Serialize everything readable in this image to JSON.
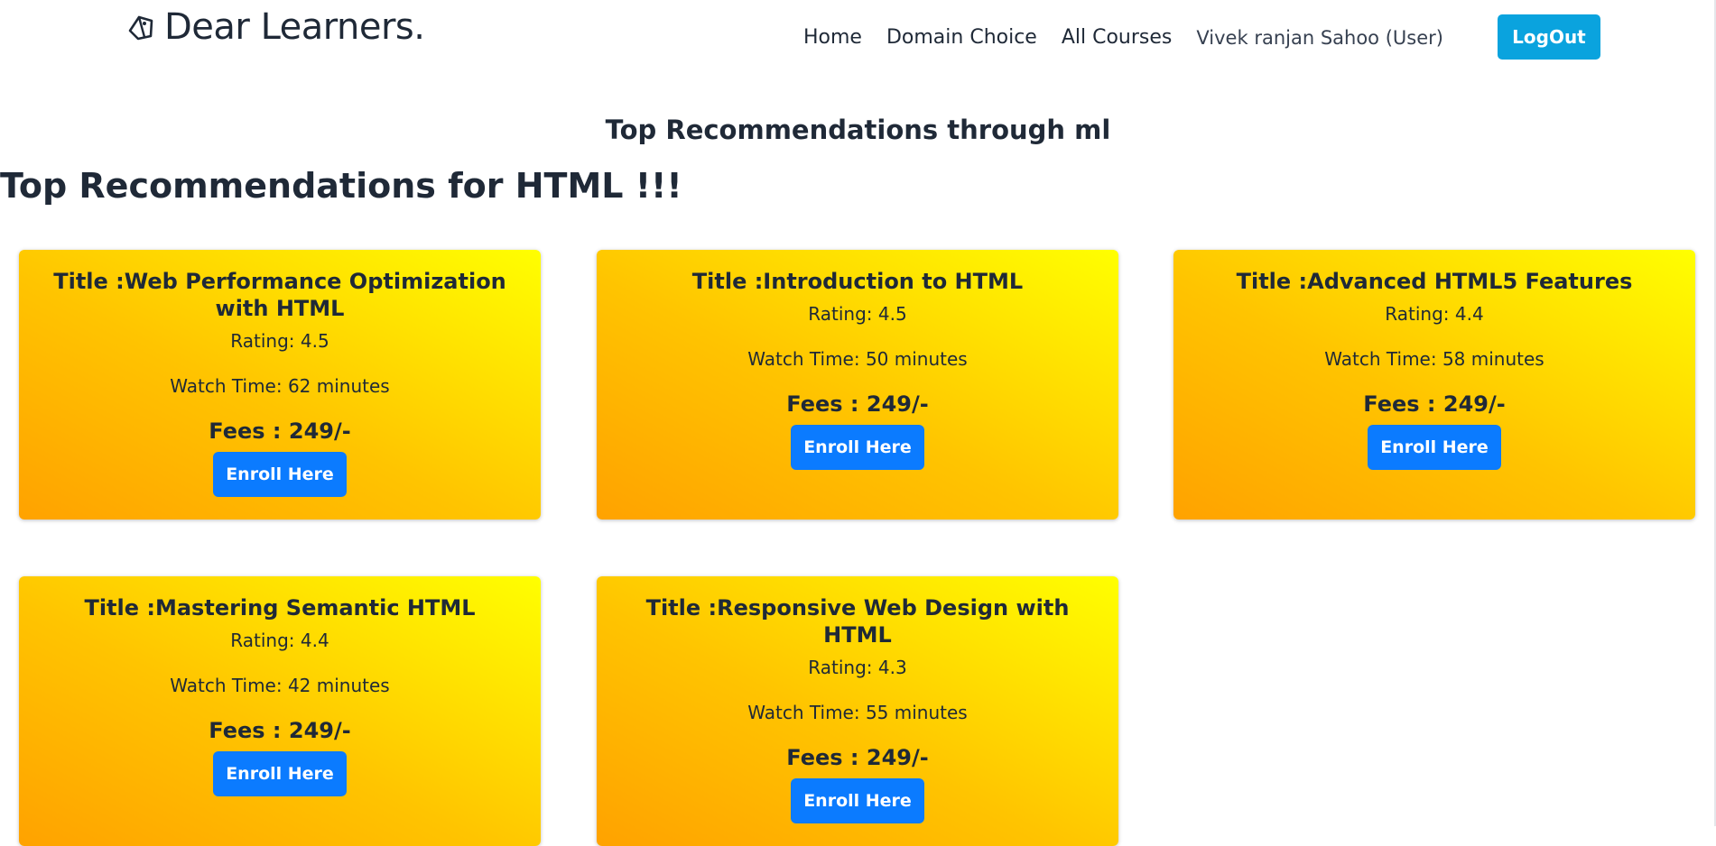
{
  "navbar": {
    "brand": "Dear Learners.",
    "brand_icon": "tag-icon",
    "links": [
      "Home",
      "Domain Choice",
      "All Courses"
    ],
    "user": "Vivek ranjan Sahoo (User)",
    "logout_label": "LogOut",
    "logout_color": "#0aa3de"
  },
  "main": {
    "ml_heading": "Top Recommendations through ml",
    "topic_heading": "Top Recommendations for HTML !!!",
    "cards": [
      {
        "title": "Title :Web Performance Optimization with HTML",
        "rating": "Rating: 4.5",
        "watch_time": "Watch Time: 62 minutes",
        "fees": "Fees : 249/-",
        "button": "Enroll Here"
      },
      {
        "title": "Title :Introduction to HTML",
        "rating": "Rating: 4.5",
        "watch_time": "Watch Time: 50 minutes",
        "fees": "Fees : 249/-",
        "button": "Enroll Here"
      },
      {
        "title": "Title :Advanced HTML5 Features",
        "rating": "Rating: 4.4",
        "watch_time": "Watch Time: 58 minutes",
        "fees": "Fees : 249/-",
        "button": "Enroll Here"
      },
      {
        "title": "Title :Mastering Semantic HTML",
        "rating": "Rating: 4.4",
        "watch_time": "Watch Time: 42 minutes",
        "fees": "Fees : 249/-",
        "button": "Enroll Here"
      },
      {
        "title": "Title :Responsive Web Design with HTML",
        "rating": "Rating: 4.3",
        "watch_time": "Watch Time: 55 minutes",
        "fees": "Fees : 249/-",
        "button": "Enroll Here"
      }
    ],
    "card_gradient": [
      "#ffa200",
      "#ffc400",
      "#ffff00"
    ],
    "enroll_color": "#0b7bff"
  }
}
